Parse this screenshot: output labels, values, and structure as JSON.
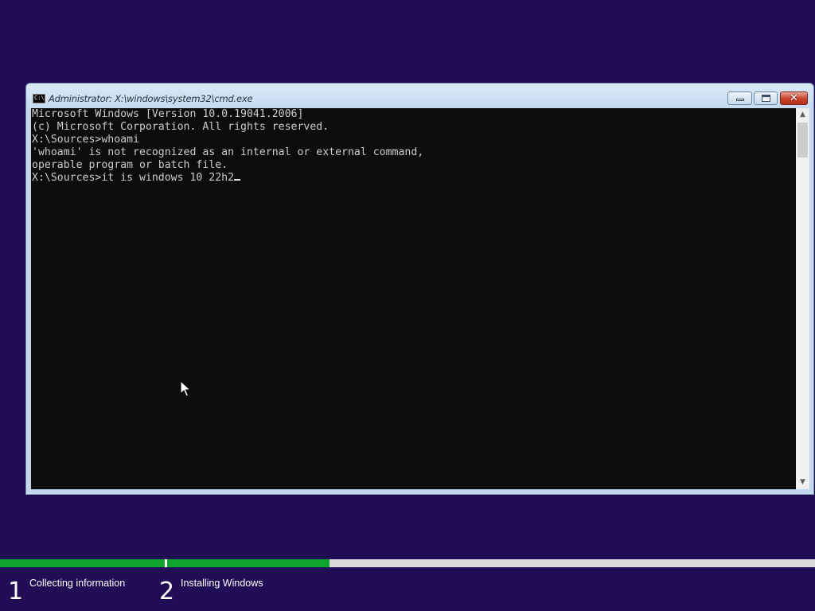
{
  "window": {
    "title": "Administrator: X:\\windows\\system32\\cmd.exe",
    "icon": "command-prompt-icon",
    "icon_glyph": "C:\\",
    "close_glyph": "✕"
  },
  "console": {
    "lines": [
      "Microsoft Windows [Version 10.0.19041.2006]",
      "(c) Microsoft Corporation. All rights reserved.",
      "",
      "X:\\Sources>whoami",
      "'whoami' is not recognized as an internal or external command,",
      "operable program or batch file.",
      "",
      "X:\\Sources>it is windows 10 22h2"
    ],
    "text_color": "#cccccc",
    "background": "#0c0c0c"
  },
  "scrollbar": {
    "up_arrow": "▲",
    "down_arrow": "▼"
  },
  "setup": {
    "background": "#210d55",
    "accent": "#0ea52e",
    "steps": [
      {
        "number": "1",
        "label": "Collecting information",
        "progress": 1.0
      },
      {
        "number": "2",
        "label": "Installing Windows",
        "progress": 0.25
      }
    ]
  }
}
